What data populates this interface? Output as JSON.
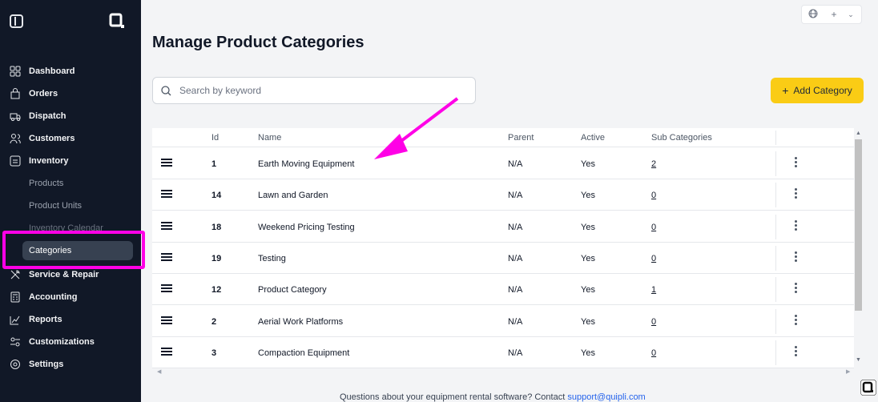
{
  "sidebar": {
    "nav": [
      {
        "label": "Dashboard",
        "icon": "dashboard-icon"
      },
      {
        "label": "Orders",
        "icon": "bag-icon"
      },
      {
        "label": "Dispatch",
        "icon": "truck-icon"
      },
      {
        "label": "Customers",
        "icon": "users-icon"
      },
      {
        "label": "Inventory",
        "icon": "inventory-icon"
      },
      {
        "label": "Service & Repair",
        "icon": "tools-icon"
      },
      {
        "label": "Accounting",
        "icon": "calculator-icon"
      },
      {
        "label": "Reports",
        "icon": "reports-icon"
      },
      {
        "label": "Customizations",
        "icon": "customize-icon"
      },
      {
        "label": "Settings",
        "icon": "settings-icon"
      }
    ],
    "sub": [
      "Products",
      "Product Units",
      "Inventory Calendar",
      "Categories"
    ]
  },
  "page": {
    "title": "Manage Product Categories",
    "search_placeholder": "Search by keyword",
    "add_label": "Add Category"
  },
  "table": {
    "headers": [
      "Id",
      "Name",
      "Parent",
      "Active",
      "Sub Categories"
    ],
    "rows": [
      {
        "id": "1",
        "name": "Earth Moving Equipment",
        "parent": "N/A",
        "active": "Yes",
        "sub": "2"
      },
      {
        "id": "14",
        "name": "Lawn and Garden",
        "parent": "N/A",
        "active": "Yes",
        "sub": "0"
      },
      {
        "id": "18",
        "name": "Weekend Pricing Testing",
        "parent": "N/A",
        "active": "Yes",
        "sub": "0"
      },
      {
        "id": "19",
        "name": "Testing",
        "parent": "N/A",
        "active": "Yes",
        "sub": "0"
      },
      {
        "id": "12",
        "name": "Product Category",
        "parent": "N/A",
        "active": "Yes",
        "sub": "1"
      },
      {
        "id": "2",
        "name": "Aerial Work Platforms",
        "parent": "N/A",
        "active": "Yes",
        "sub": "0"
      },
      {
        "id": "3",
        "name": "Compaction Equipment",
        "parent": "N/A",
        "active": "Yes",
        "sub": "0"
      }
    ]
  },
  "footer": {
    "text": "Questions about your equipment rental software? Contact ",
    "email": "support@quipli.com"
  },
  "colors": {
    "accent": "#facc15",
    "annotation": "#ff00e6",
    "sidebar": "#111827"
  }
}
